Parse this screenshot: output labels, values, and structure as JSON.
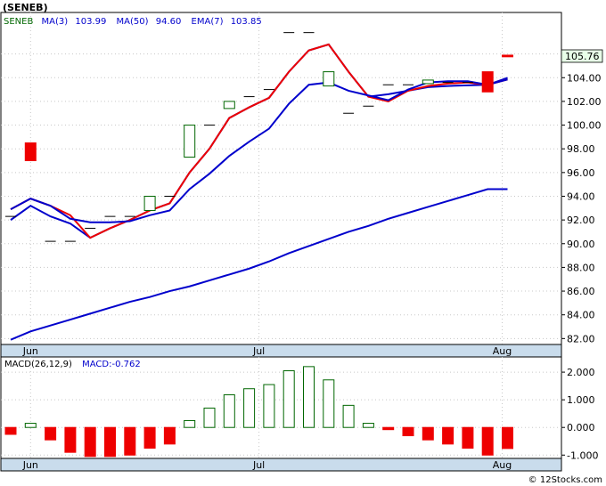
{
  "title": "(SENEB)",
  "watermark": "© 12Stocks.com",
  "price_legend": {
    "symbol": "SENEB",
    "ma3": "MA(3)",
    "ma3_value": "103.99",
    "ma50": "MA(50)",
    "ma50_value": "94.60",
    "ema7": "EMA(7)",
    "ema7_value": "103.85"
  },
  "last_price_label": "105.76",
  "macd_legend": {
    "name": "MACD(26,12,9)",
    "value_label": "MACD:-0.762"
  },
  "colors": {
    "ma_line": "#0000cc",
    "ema_line": "#ee0000",
    "up_candle": "#006600",
    "down_candle": "#ee0000",
    "panel_bg": "#ffffff",
    "axis_strip": "#c9dcec",
    "grid": "#c8c8c8",
    "price_tag_bg": "#e8ffe8"
  },
  "chart_data": [
    {
      "type": "candlestick",
      "title": "(SENEB)",
      "ylim": [
        81.5,
        109.5
      ],
      "yticks": [
        "82.00",
        "84.00",
        "86.00",
        "88.00",
        "90.00",
        "92.00",
        "94.00",
        "96.00",
        "98.00",
        "100.00",
        "102.00",
        "104.00",
        "106.00"
      ],
      "ytick_values": [
        82,
        84,
        86,
        88,
        90,
        92,
        94,
        96,
        98,
        100,
        102,
        104,
        106
      ],
      "x_tick_labels": [
        {
          "label": "Jun",
          "index": 1
        },
        {
          "label": "Jul",
          "index": 12
        },
        {
          "label": "Aug",
          "index": 25
        }
      ],
      "num_slots": 27,
      "candles": [
        {
          "i": 0,
          "o": 92.3,
          "c": 92.3
        },
        {
          "i": 1,
          "o": 98.5,
          "c": 97.0
        },
        {
          "i": 2,
          "o": 90.2,
          "c": 90.2
        },
        {
          "i": 3,
          "o": 90.2,
          "c": 90.2
        },
        {
          "i": 4,
          "o": 91.3,
          "c": 91.3
        },
        {
          "i": 5,
          "o": 92.3,
          "c": 92.3
        },
        {
          "i": 6,
          "o": 92.3,
          "c": 92.3
        },
        {
          "i": 7,
          "o": 92.8,
          "c": 94.0
        },
        {
          "i": 8,
          "o": 94.0,
          "c": 94.0
        },
        {
          "i": 9,
          "o": 97.3,
          "c": 100.0
        },
        {
          "i": 10,
          "o": 100.0,
          "c": 100.0
        },
        {
          "i": 11,
          "o": 101.4,
          "c": 102.0
        },
        {
          "i": 12,
          "o": 102.4,
          "c": 102.4
        },
        {
          "i": 13,
          "o": 103.0,
          "c": 103.0
        },
        {
          "i": 14,
          "o": 107.8,
          "c": 107.8
        },
        {
          "i": 15,
          "o": 107.8,
          "c": 107.8
        },
        {
          "i": 16,
          "o": 103.3,
          "c": 104.5
        },
        {
          "i": 17,
          "o": 101.0,
          "c": 101.0
        },
        {
          "i": 18,
          "o": 101.6,
          "c": 101.6
        },
        {
          "i": 19,
          "o": 103.4,
          "c": 103.4
        },
        {
          "i": 20,
          "o": 103.4,
          "c": 103.4
        },
        {
          "i": 21,
          "o": 103.5,
          "c": 103.8
        },
        {
          "i": 22,
          "o": 103.6,
          "c": 103.6
        },
        {
          "i": 23,
          "o": 103.6,
          "c": 103.6
        },
        {
          "i": 24,
          "o": 104.5,
          "c": 102.8
        },
        {
          "i": 25,
          "o": 105.9,
          "c": 105.76
        }
      ],
      "series": [
        {
          "name": "MA(3)",
          "color": "#0000cc",
          "x": [
            0,
            1,
            2,
            3,
            4,
            5,
            6,
            7,
            8,
            9,
            10,
            11,
            12,
            13,
            14,
            15,
            16,
            17,
            18,
            19,
            20,
            21,
            22,
            23,
            24,
            25
          ],
          "values": [
            92.0,
            93.2,
            92.3,
            91.7,
            90.5,
            91.3,
            92.0,
            92.8,
            93.4,
            96.0,
            98.0,
            100.6,
            101.5,
            102.3,
            104.5,
            106.3,
            106.8,
            104.5,
            102.4,
            102.6,
            102.9,
            103.2,
            103.3,
            103.35,
            103.4,
            103.99
          ]
        },
        {
          "name": "EMA(7)",
          "color": "#ee0000",
          "x": [
            0,
            1,
            2,
            3,
            4,
            5,
            6,
            7,
            8,
            9,
            10,
            11,
            12,
            13,
            14,
            15,
            16,
            17,
            18,
            19,
            20,
            21,
            22,
            23,
            24,
            25
          ],
          "values": [
            92.9,
            93.8,
            93.2,
            92.4,
            90.5,
            91.3,
            92.0,
            92.8,
            93.4,
            96.0,
            98.0,
            100.6,
            101.5,
            102.3,
            104.5,
            106.3,
            106.8,
            104.5,
            102.4,
            102.0,
            102.9,
            103.3,
            103.5,
            103.6,
            103.4,
            103.85
          ]
        },
        {
          "name": "EMA(7) overlap",
          "color": "#0000cc",
          "x": [
            0,
            1,
            2,
            3,
            4,
            5,
            6,
            7,
            8,
            9,
            10,
            11,
            12,
            13,
            14,
            15,
            16,
            17,
            18,
            19,
            20,
            21,
            22,
            23,
            24,
            25
          ],
          "values": [
            92.9,
            93.8,
            93.2,
            92.1,
            91.8,
            91.8,
            91.9,
            92.4,
            92.8,
            94.6,
            95.9,
            97.4,
            98.6,
            99.7,
            101.8,
            103.4,
            103.6,
            102.9,
            102.5,
            102.1,
            103.0,
            103.6,
            103.7,
            103.7,
            103.4,
            103.85
          ]
        },
        {
          "name": "MA(50)",
          "color": "#0000cc",
          "x": [
            0,
            1,
            2,
            3,
            4,
            5,
            6,
            7,
            8,
            9,
            10,
            11,
            12,
            13,
            14,
            15,
            16,
            17,
            18,
            19,
            20,
            21,
            22,
            23,
            24,
            25
          ],
          "values": [
            81.9,
            82.6,
            83.1,
            83.6,
            84.1,
            84.6,
            85.1,
            85.5,
            86.0,
            86.4,
            86.9,
            87.4,
            87.9,
            88.5,
            89.2,
            89.8,
            90.4,
            91.0,
            91.5,
            92.1,
            92.6,
            93.1,
            93.6,
            94.1,
            94.6,
            94.6
          ]
        }
      ]
    },
    {
      "type": "bar",
      "title": "MACD(26,12,9)",
      "ylim": [
        -1.12,
        2.55
      ],
      "yticks": [
        "-1.000",
        "0.000",
        "1.000",
        "2.000"
      ],
      "ytick_values": [
        -1,
        0,
        1,
        2
      ],
      "x_tick_labels": [
        {
          "label": "Jun",
          "index": 1
        },
        {
          "label": "Jul",
          "index": 12
        },
        {
          "label": "Aug",
          "index": 25
        }
      ],
      "x": [
        0,
        1,
        2,
        3,
        4,
        5,
        6,
        7,
        8,
        9,
        10,
        11,
        12,
        13,
        14,
        15,
        16,
        17,
        18,
        19,
        20,
        21,
        22,
        23,
        24,
        25
      ],
      "values": [
        -0.25,
        0.15,
        -0.45,
        -0.9,
        -1.05,
        -1.05,
        -1.0,
        -0.75,
        -0.6,
        0.25,
        0.7,
        1.18,
        1.4,
        1.55,
        2.05,
        2.2,
        1.72,
        0.8,
        0.15,
        -0.08,
        -0.3,
        -0.45,
        -0.6,
        -0.75,
        -1.0,
        -0.762
      ]
    }
  ]
}
